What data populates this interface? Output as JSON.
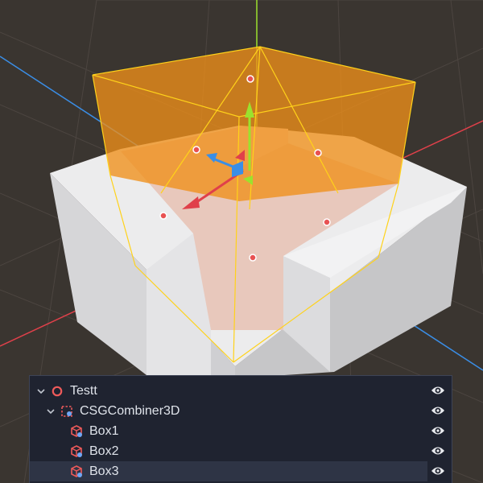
{
  "viewport": {
    "colors": {
      "background": "#3a3530",
      "grid": "#4c4540",
      "axis_x": "#e0404a",
      "axis_y": "#9be22e",
      "axis_z": "#3a8ee6",
      "cube_top": "#ededee",
      "cube_side_left": "#d2d2d4",
      "cube_side_right": "#c4c4c6",
      "cavity": "#e7c9be",
      "selection_fill": "#f0901a",
      "selection_outline": "#ffd21a",
      "handle_dot": "#e85252"
    }
  },
  "scene_tree": {
    "nodes": [
      {
        "label": "Testt",
        "icon": "node-circle-icon",
        "expanded": true,
        "depth": 0,
        "selected": false
      },
      {
        "label": "CSGCombiner3D",
        "icon": "csg-combiner-icon",
        "expanded": true,
        "depth": 1,
        "selected": false
      },
      {
        "label": "Box1",
        "icon": "csg-box-icon",
        "depth": 2,
        "selected": false
      },
      {
        "label": "Box2",
        "icon": "csg-box-icon",
        "depth": 2,
        "selected": false
      },
      {
        "label": "Box3",
        "icon": "csg-box-icon",
        "depth": 2,
        "selected": true
      }
    ],
    "colors": {
      "panel": "#1f2330",
      "text": "#dfe3ea",
      "icon_red": "#ee5a5a",
      "icon_blue": "#6ea6f5",
      "eye": "#e8eaee"
    }
  }
}
